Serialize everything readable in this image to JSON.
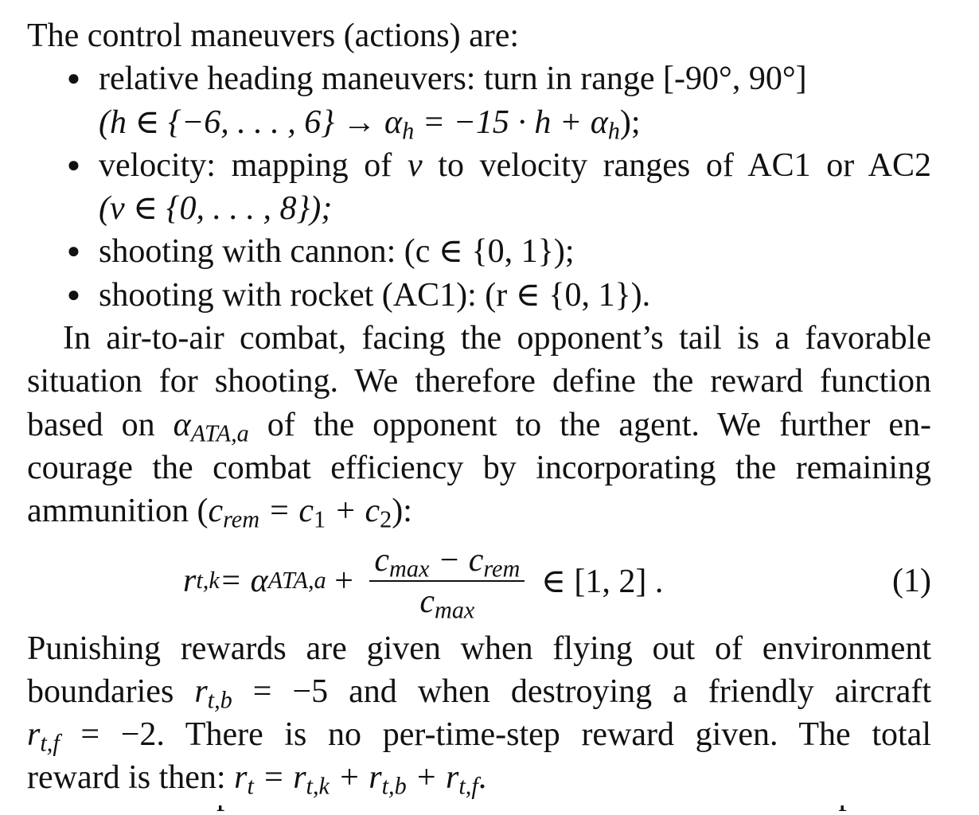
{
  "heading": "The control maneuvers (actions) are:",
  "bullets": [
    {
      "line1": "relative heading maneuvers: turn in range [-90°, 90°]",
      "line2": "(h ∈ {−6, . . . , 6} → α",
      "line2_sub": "h",
      "line2_rest": " = −15 · h + α",
      "line2_sub2": "h",
      "line2_end": ");"
    },
    {
      "line1_a": "velocity: mapping of ",
      "line1_var": "v",
      "line1_b": " to velocity ranges of AC1 or AC2",
      "line2": "(v ∈ {0, . . . , 8});"
    },
    {
      "line1": "shooting with cannon: (c ∈ {0, 1});"
    },
    {
      "line1": "shooting with rocket (AC1): (r ∈ {0, 1})."
    }
  ],
  "paragraph1": {
    "line1": "In air-to-air combat, facing the opponent’s tail is a favorable",
    "line2": "situation for shooting. We therefore define the reward function",
    "line3_a": "based on ",
    "line3_var": "α",
    "line3_sub": "ATA,a",
    "line3_b": " of the opponent to the agent. We further en-",
    "line4": "courage the combat efficiency by incorporating the remaining",
    "line5_a": "ammunition (",
    "line5_var": "c",
    "line5_sub": "rem",
    "line5_b": " = c",
    "line5_sub1": "1",
    "line5_c": " + c",
    "line5_sub2": "2",
    "line5_d": "):"
  },
  "equation": {
    "lhs": "r",
    "lhs_sub": "t,k",
    "eq": " = α",
    "alpha_sub": "ATA,a",
    "plus": " + ",
    "numerator": "c",
    "num_sub1": "max",
    "num_minus": " − c",
    "num_sub2": "rem",
    "denominator": "c",
    "den_sub": "max",
    "tail": " ∈ [1, 2] .",
    "number": "(1)"
  },
  "paragraph2": {
    "line1": "Punishing rewards are given when flying out of environment",
    "line2_a": "boundaries ",
    "line2_var": "r",
    "line2_sub": "t,b",
    "line2_b": " = −5 and when destroying a friendly aircraft",
    "line3_var": "r",
    "line3_sub": "t,f",
    "line3_b": " = −2. There is no per-time-step reward given. The total",
    "line4_a": "reward is then: ",
    "line4_var": "r",
    "line4_sub": "t",
    "line4_b": " = r",
    "line4_sub2": "t,k",
    "line4_c": " + r",
    "line4_sub3": "t,b",
    "line4_d": " + r",
    "line4_sub4": "t,f",
    "line4_e": "."
  },
  "cutoff_text": "After some exploration with ammunition and a standard setup of the"
}
